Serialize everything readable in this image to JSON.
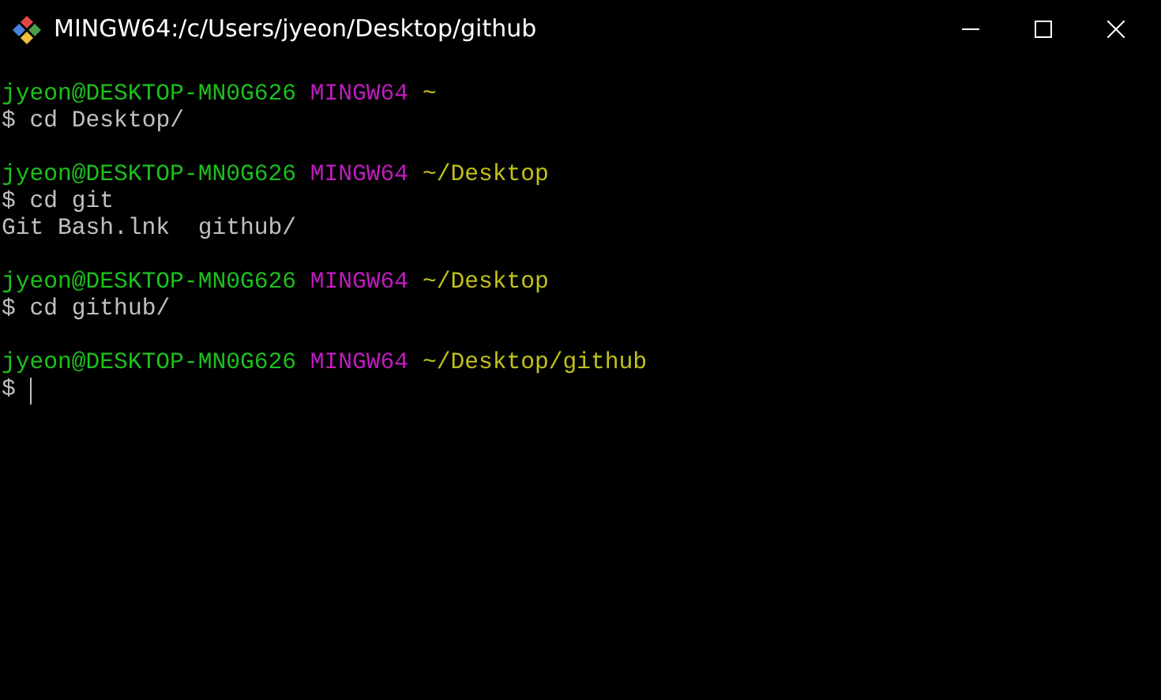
{
  "window": {
    "title": "MINGW64:/c/Users/jyeon/Desktop/github"
  },
  "terminal": {
    "lines": [
      {
        "kind": "prompt",
        "user_host": "jyeon@DESKTOP-MN0G626",
        "shell": "MINGW64",
        "path": "~"
      },
      {
        "kind": "command",
        "sign": "$",
        "text": "cd Desktop/",
        "cursor": false
      },
      {
        "kind": "blank"
      },
      {
        "kind": "prompt",
        "user_host": "jyeon@DESKTOP-MN0G626",
        "shell": "MINGW64",
        "path": "~/Desktop"
      },
      {
        "kind": "command",
        "sign": "$",
        "text": "cd git",
        "cursor": false
      },
      {
        "kind": "output",
        "text": "Git Bash.lnk  github/"
      },
      {
        "kind": "blank"
      },
      {
        "kind": "prompt",
        "user_host": "jyeon@DESKTOP-MN0G626",
        "shell": "MINGW64",
        "path": "~/Desktop"
      },
      {
        "kind": "command",
        "sign": "$",
        "text": "cd github/",
        "cursor": false
      },
      {
        "kind": "blank"
      },
      {
        "kind": "prompt",
        "user_host": "jyeon@DESKTOP-MN0G626",
        "shell": "MINGW64",
        "path": "~/Desktop/github"
      },
      {
        "kind": "command",
        "sign": "$",
        "cursor": true
      }
    ]
  }
}
